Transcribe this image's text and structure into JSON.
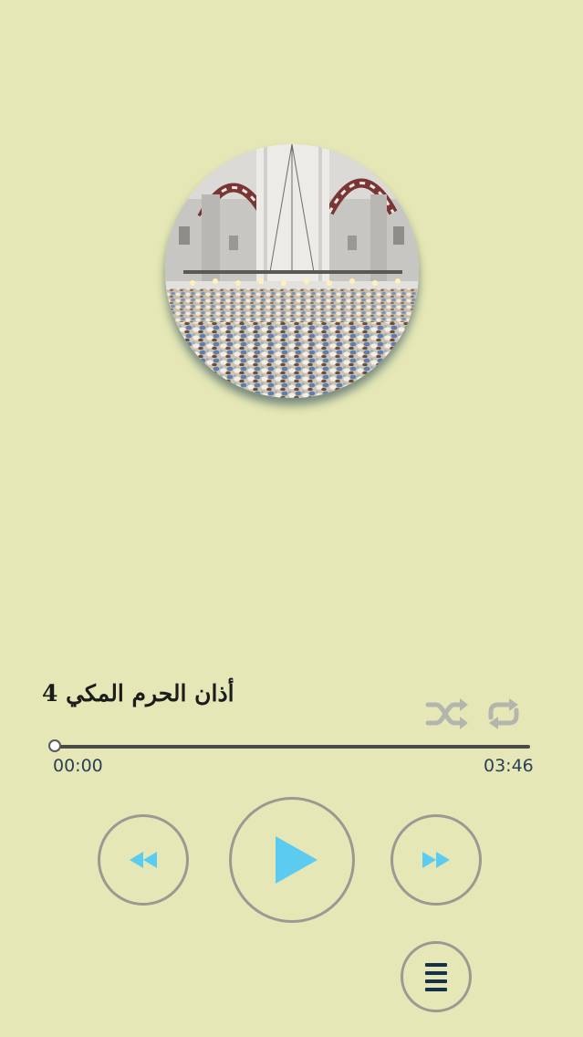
{
  "track": {
    "title": "أذان الحرم المكي 4",
    "elapsed": "00:00",
    "duration": "03:46",
    "progress": 0
  },
  "icons": {
    "shuffle": "shuffle-icon",
    "repeat": "repeat-icon",
    "rewind": "rewind-icon",
    "play": "play-icon",
    "fast_forward": "fast-forward-icon",
    "menu": "menu-icon"
  },
  "colors": {
    "background": "#e5e8b6",
    "accent": "#5ccbf0",
    "control_border": "#9a9a93",
    "disabled_icon": "#b4b6ae",
    "time_text": "#2c3e58"
  }
}
